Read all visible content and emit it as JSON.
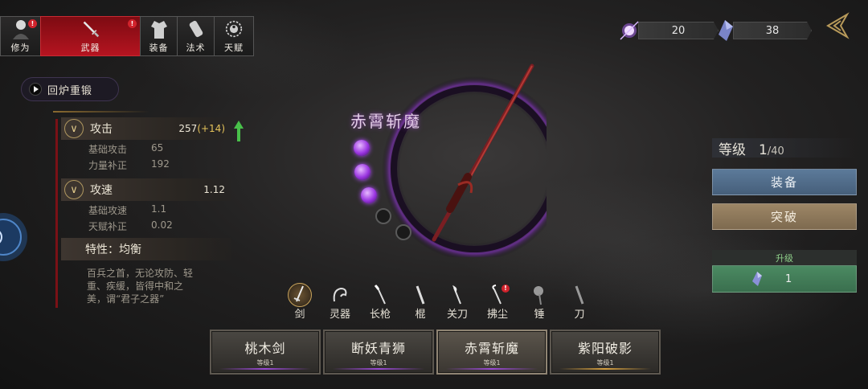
{
  "top_tabs": [
    {
      "label": "修为",
      "icon": "cultivator-portrait-icon",
      "badge": "!"
    },
    {
      "label": "武器",
      "icon": "sword-icon",
      "badge": "!",
      "active": true
    },
    {
      "label": "装备",
      "icon": "robe-icon",
      "badge": ""
    },
    {
      "label": "法术",
      "icon": "scroll-icon",
      "badge": ""
    },
    {
      "label": "天赋",
      "icon": "taiji-icon",
      "badge": ""
    }
  ],
  "currency": {
    "orb_count": "20",
    "crystal_count": "38"
  },
  "reforge": {
    "label": "回炉重锻"
  },
  "stats": {
    "attack": {
      "name": "攻击",
      "value": "257",
      "bonus": "(+14)",
      "rows": [
        {
          "label": "基础攻击",
          "value": "65"
        },
        {
          "label": "力量补正",
          "value": "192"
        }
      ]
    },
    "speed": {
      "name": "攻速",
      "value": "1.12",
      "rows": [
        {
          "label": "基础攻速",
          "value": "1.1"
        },
        {
          "label": "天赋补正",
          "value": "0.02"
        }
      ]
    },
    "trait": {
      "title": "特性：均衡",
      "description": "百兵之首，无论攻防、轻重、疾缓，皆得中和之美，谓“君子之器”"
    }
  },
  "weapon": {
    "name": "赤霄斩魔",
    "star_orbs_filled": 3,
    "star_orbs_total": 5
  },
  "level": {
    "label": "等级",
    "current": "1",
    "max": "/40"
  },
  "buttons": {
    "equip": "装备",
    "breakthrough": "突破"
  },
  "upgrade": {
    "label": "升级",
    "cost": "1"
  },
  "categories": [
    {
      "label": "剑",
      "icon": "sword-category-icon",
      "active": true,
      "badge": ""
    },
    {
      "label": "灵器",
      "icon": "spirit-artifact-icon",
      "active": false,
      "badge": ""
    },
    {
      "label": "长枪",
      "icon": "spear-icon",
      "active": false,
      "badge": ""
    },
    {
      "label": "棍",
      "icon": "staff-icon",
      "active": false,
      "badge": ""
    },
    {
      "label": "关刀",
      "icon": "guandao-icon",
      "active": false,
      "badge": ""
    },
    {
      "label": "拂尘",
      "icon": "whisk-icon",
      "active": false,
      "badge": "!"
    },
    {
      "label": "锤",
      "icon": "hammer-icon",
      "active": false,
      "badge": ""
    },
    {
      "label": "刀",
      "icon": "saber-icon",
      "active": false,
      "badge": ""
    }
  ],
  "weapon_cards": [
    {
      "name": "桃木剑",
      "level": "等级1",
      "line": "purple",
      "selected": false
    },
    {
      "name": "断妖青狮",
      "level": "等级1",
      "line": "purple",
      "selected": false
    },
    {
      "name": "赤霄斩魔",
      "level": "等级1",
      "line": "purple",
      "selected": true
    },
    {
      "name": "紫阳破影",
      "level": "等级1",
      "line": "gold",
      "selected": false
    }
  ],
  "colors": {
    "active_tab": "#b51420",
    "equip_button": "#5c7a9a",
    "breakthrough_button": "#9d8666",
    "upgrade_button": "#4b8a62",
    "orb_purple": "#9a35e0"
  }
}
